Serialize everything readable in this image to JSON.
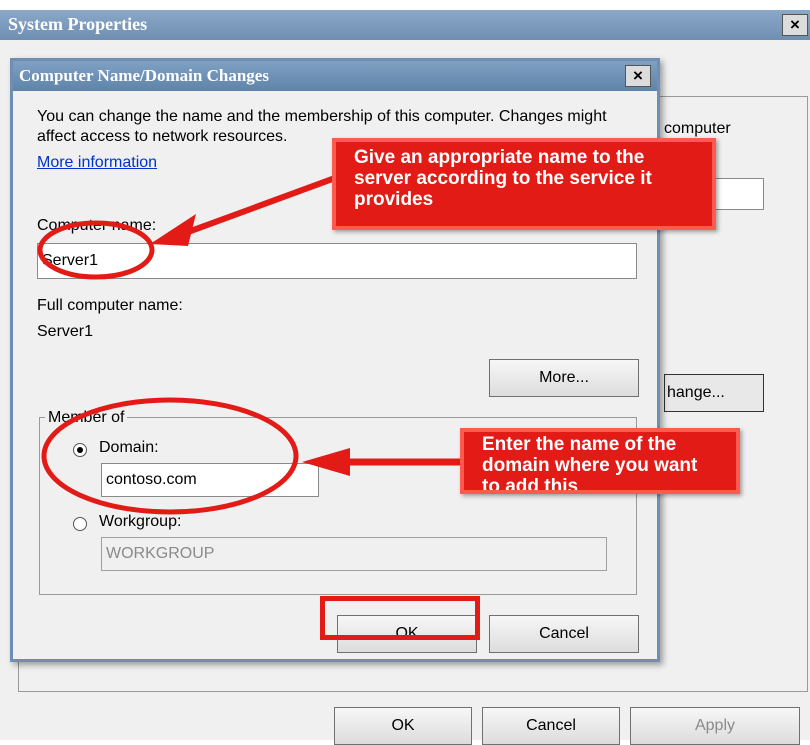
{
  "system_properties": {
    "title": "System Properties",
    "close_label": "×",
    "right_text": "computer",
    "change_button_label": "hange...",
    "ok_label": "OK",
    "cancel_label": "Cancel",
    "apply_label": "Apply"
  },
  "dialog": {
    "title": "Computer Name/Domain Changes",
    "close_label": "×",
    "description": "You can change the name and the membership of this computer. Changes might affect access to network resources.",
    "more_info_link": "More information",
    "computer_name_label": "Computer name:",
    "computer_name_value": "Server1",
    "full_name_label": "Full computer name:",
    "full_name_value": "Server1",
    "more_button_label": "More...",
    "member_of_label": "Member of",
    "domain_label": "Domain:",
    "domain_value": "contoso.com",
    "domain_selected": true,
    "workgroup_label": "Workgroup:",
    "workgroup_value": "WORKGROUP",
    "ok_label": "OK",
    "cancel_label": "Cancel"
  },
  "annotations": {
    "callout_name": "Give an appropriate name to the server according to the service it provides",
    "callout_domain": "Enter the name of the domain where you want to add this",
    "accent_color": "#e31b17"
  }
}
